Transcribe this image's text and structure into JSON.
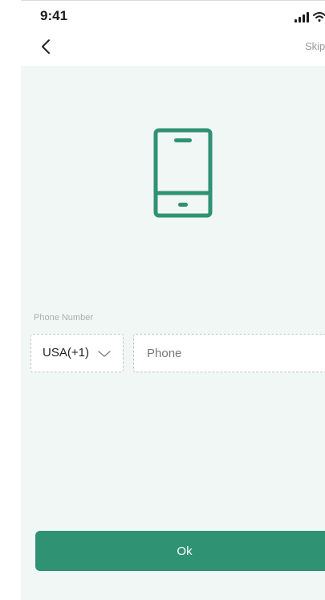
{
  "status_bar": {
    "time": "9:41",
    "icons": [
      "signal-icon",
      "wifi-icon",
      "battery-icon"
    ]
  },
  "nav": {
    "back_icon": "chevron-left-icon",
    "skip_label": "Skip"
  },
  "illustration": {
    "icon": "mobile-phone-icon",
    "color": "#2f9273"
  },
  "form": {
    "phone_label": "Phone Number",
    "country_code": "USA(+1)",
    "country_icon": "chevron-down-icon",
    "phone_value": "",
    "phone_placeholder": "Phone"
  },
  "actions": {
    "ok_label": "Ok",
    "ok_color": "#2f9273"
  },
  "colors": {
    "background": "#f1f7f5",
    "accent": "#2f9273"
  }
}
